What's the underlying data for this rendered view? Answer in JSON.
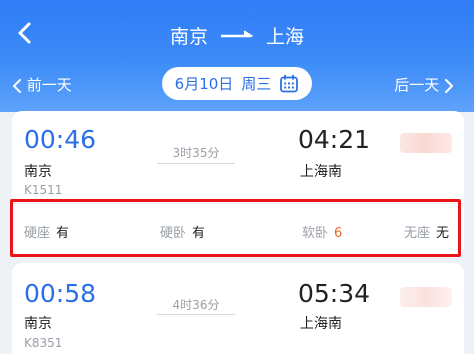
{
  "header": {
    "from": "南京",
    "to": "上海",
    "prev_day": "前一天",
    "next_day": "后一天",
    "date": "6月10日",
    "weekday": "周三"
  },
  "icons": {
    "back": "back-chevron-icon",
    "arrow": "right-arrow-icon",
    "calendar": "calendar-icon"
  },
  "trains": [
    {
      "depart_time": "00:46",
      "arrive_time": "04:21",
      "duration": "3时35分",
      "from_station": "南京",
      "to_station": "上海南",
      "train_no": "K1511",
      "seats": [
        {
          "name": "硬座",
          "availability": "有"
        },
        {
          "name": "硬卧",
          "availability": "有"
        },
        {
          "name": "软卧",
          "availability": "6"
        },
        {
          "name": "无座",
          "availability": "无"
        }
      ]
    },
    {
      "depart_time": "00:58",
      "arrive_time": "05:34",
      "duration": "4时36分",
      "from_station": "南京",
      "to_station": "上海南",
      "train_no": "K8351"
    }
  ],
  "colors": {
    "header_blue": "#2f7cf6",
    "accent_blue": "#2a6fe6",
    "highlight_red": "#e8141a",
    "count_orange": "#e8662c"
  }
}
